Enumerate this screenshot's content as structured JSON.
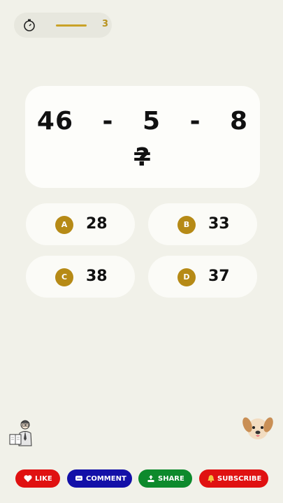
{
  "timer": {
    "count": "3",
    "progress": 0.3,
    "icon": "stopwatch-icon"
  },
  "question": {
    "expression": "46 - 5 - 8 =",
    "unknown": "?"
  },
  "answers": [
    {
      "letter": "A",
      "value": "28"
    },
    {
      "letter": "B",
      "value": "33"
    },
    {
      "letter": "C",
      "value": "38"
    },
    {
      "letter": "D",
      "value": "37"
    }
  ],
  "buttons": {
    "like": "LIKE",
    "comment": "COMMENT",
    "share": "SHARE",
    "subscribe": "SUBSCRIBE"
  },
  "colors": {
    "background": "#f1f1e9",
    "accent_gold": "#b68a16",
    "like": "#e01111",
    "comment": "#1310a8",
    "share": "#0d8a2c",
    "subscribe": "#e01111"
  }
}
